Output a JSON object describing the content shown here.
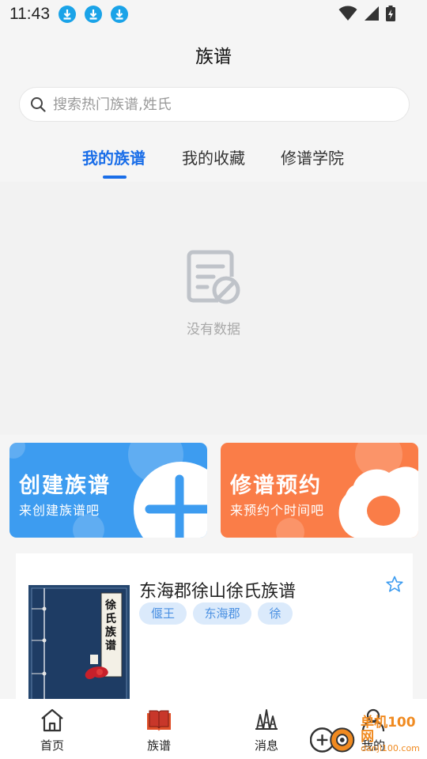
{
  "status_bar": {
    "time": "11:43"
  },
  "header": {
    "title": "族谱"
  },
  "search": {
    "placeholder": "搜索热门族谱,姓氏"
  },
  "tabs": [
    {
      "label": "我的族谱",
      "active": true
    },
    {
      "label": "我的收藏",
      "active": false
    },
    {
      "label": "修谱学院",
      "active": false
    }
  ],
  "empty_state": {
    "text": "没有数据"
  },
  "cards": {
    "create": {
      "title": "创建族谱",
      "subtitle": "来创建族谱吧",
      "color": "#3d9cf0"
    },
    "appoint": {
      "title": "修谱预约",
      "subtitle": "来预约个时间吧",
      "color": "#fa7d48"
    }
  },
  "book": {
    "name": "东海郡徐山徐氏族谱",
    "cover_title": "徐氏族谱",
    "tags": [
      "偃王",
      "东海郡",
      "徐"
    ]
  },
  "nav": [
    {
      "label": "首页",
      "icon": "home-icon"
    },
    {
      "label": "族谱",
      "icon": "book-icon"
    },
    {
      "label": "消息",
      "icon": "message-icon"
    },
    {
      "label": "我的",
      "icon": "user-icon"
    }
  ],
  "watermark": {
    "line1": "单机100网",
    "line2": "danji100.com"
  },
  "colors": {
    "accent": "#1a6ee8",
    "tag_bg": "#dbeafb",
    "tag_text": "#4a90e2"
  }
}
